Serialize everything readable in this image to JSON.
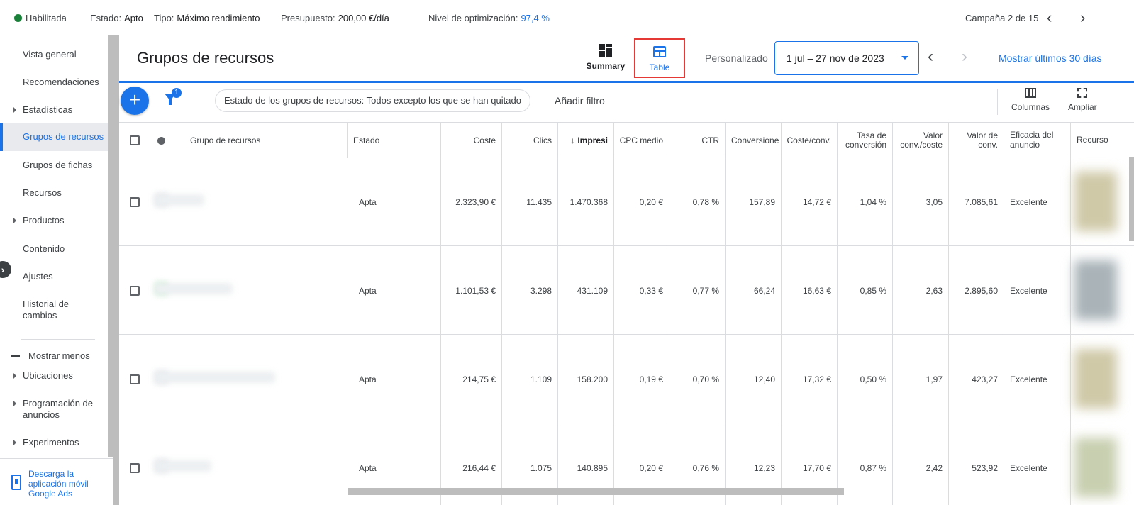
{
  "topbar": {
    "status": "Habilitada",
    "estado_label": "Estado:",
    "estado_value": "Apto",
    "tipo_label": "Tipo:",
    "tipo_value": "Máximo rendimiento",
    "presupuesto_label": "Presupuesto:",
    "presupuesto_value": "200,00 €/día",
    "optimizacion_label": "Nivel de optimización:",
    "optimizacion_value": "97,4 %",
    "campaign_counter": "Campaña 2 de 15"
  },
  "sidebar": {
    "items": [
      {
        "label": "Vista general"
      },
      {
        "label": "Recomendaciones"
      },
      {
        "label": "Estadísticas"
      },
      {
        "label": "Grupos de recursos"
      },
      {
        "label": "Grupos de fichas"
      },
      {
        "label": "Recursos"
      },
      {
        "label": "Productos"
      },
      {
        "label": "Contenido"
      },
      {
        "label": "Ajustes"
      },
      {
        "label": "Historial de cambios"
      },
      {
        "label": "Ubicaciones"
      },
      {
        "label": "Programación de anuncios"
      },
      {
        "label": "Experimentos"
      }
    ],
    "show_less": "Mostrar menos",
    "download": "Descarga la aplicación móvil Google Ads"
  },
  "header": {
    "title": "Grupos de recursos",
    "summary_label": "Summary",
    "table_label": "Table",
    "custom_label": "Personalizado",
    "date_range": "1 jul – 27 nov de 2023",
    "last30": "Mostrar últimos 30 días"
  },
  "toolbar": {
    "filter_count": "1",
    "filter_chip": "Estado de los grupos de recursos: Todos excepto los que se han quitado",
    "add_filter": "Añadir filtro",
    "columns": "Columnas",
    "expand": "Ampliar"
  },
  "table": {
    "headers": {
      "group": "Grupo de recursos",
      "estado": "Estado",
      "coste": "Coste",
      "clics": "Clics",
      "impr": "Impresi",
      "cpc": "CPC medio",
      "ctr": "CTR",
      "conv": "Conversione",
      "coste_conv": "Coste/conv.",
      "tasa1": "Tasa de",
      "tasa2": "conversión",
      "valor1": "Valor",
      "valor2": "conv./coste",
      "vconv1": "Valor de",
      "vconv2": "conv.",
      "eficacia1": "Eficacia del",
      "eficacia2": "anuncio",
      "recursos": "Recurso"
    },
    "rows": [
      {
        "estado": "Apta",
        "coste": "2.323,90 €",
        "clics": "11.435",
        "impr": "1.470.368",
        "cpc": "0,20 €",
        "ctr": "0,78 %",
        "conv": "157,89",
        "coste_conv": "14,72 €",
        "tasa": "1,04 %",
        "valor": "3,05",
        "vconv": "7.085,61",
        "eficacia": "Excelente"
      },
      {
        "estado": "Apta",
        "coste": "1.101,53 €",
        "clics": "3.298",
        "impr": "431.109",
        "cpc": "0,33 €",
        "ctr": "0,77 %",
        "conv": "66,24",
        "coste_conv": "16,63 €",
        "tasa": "0,85 %",
        "valor": "2,63",
        "vconv": "2.895,60",
        "eficacia": "Excelente"
      },
      {
        "estado": "Apta",
        "coste": "214,75 €",
        "clics": "1.109",
        "impr": "158.200",
        "cpc": "0,19 €",
        "ctr": "0,70 %",
        "conv": "12,40",
        "coste_conv": "17,32 €",
        "tasa": "0,50 %",
        "valor": "1,97",
        "vconv": "423,27",
        "eficacia": "Excelente"
      },
      {
        "estado": "Apta",
        "coste": "216,44 €",
        "clics": "1.075",
        "impr": "140.895",
        "cpc": "0,20 €",
        "ctr": "0,76 %",
        "conv": "12,23",
        "coste_conv": "17,70 €",
        "tasa": "0,87 %",
        "valor": "2,42",
        "vconv": "523,92",
        "eficacia": "Excelente"
      }
    ]
  },
  "colors": {
    "accent": "#1a73e8",
    "enabled": "#188038",
    "highlight": "#e53935"
  }
}
